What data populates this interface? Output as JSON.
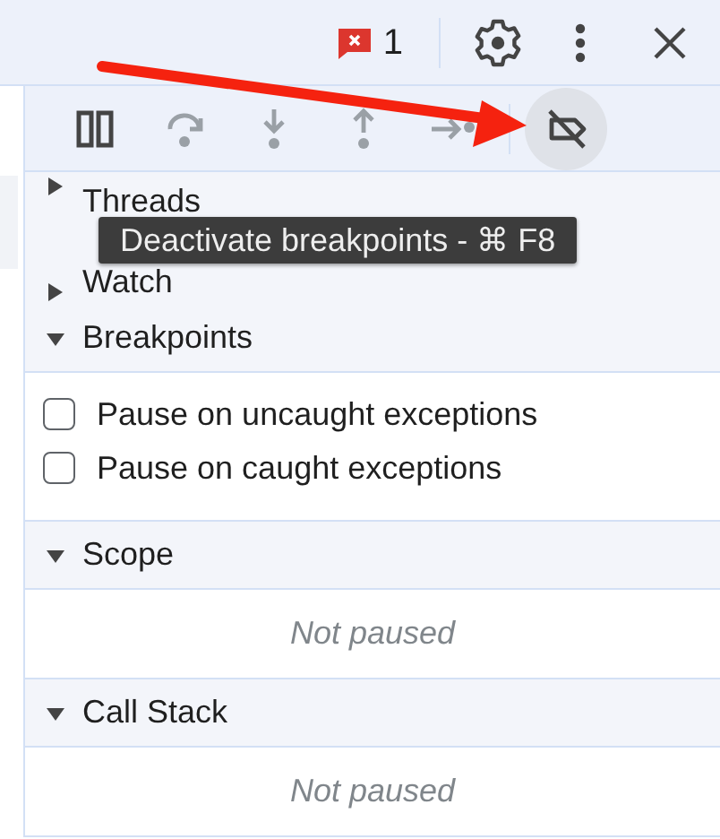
{
  "top_bar": {
    "error_count": "1"
  },
  "debugger_toolbar": {
    "buttons": [
      {
        "kind": "pause",
        "disabled": false,
        "hovered": false
      },
      {
        "kind": "step-over",
        "disabled": true,
        "hovered": false
      },
      {
        "kind": "step-into",
        "disabled": true,
        "hovered": false
      },
      {
        "kind": "step-out",
        "disabled": true,
        "hovered": false
      },
      {
        "kind": "step",
        "disabled": true,
        "hovered": false
      },
      {
        "kind": "deactivate-breakpoints",
        "disabled": false,
        "hovered": true
      }
    ]
  },
  "tooltip": {
    "text": "Deactivate breakpoints - ⌘ F8"
  },
  "sections": [
    {
      "title": "Threads",
      "expanded": false
    },
    {
      "title": "Watch",
      "expanded": false
    },
    {
      "title": "Breakpoints",
      "expanded": true,
      "checkboxes": [
        {
          "label": "Pause on uncaught exceptions",
          "checked": false
        },
        {
          "label": "Pause on caught exceptions",
          "checked": false
        }
      ]
    },
    {
      "title": "Scope",
      "expanded": true,
      "message": "Not paused"
    },
    {
      "title": "Call Stack",
      "expanded": true,
      "message": "Not paused"
    }
  ]
}
